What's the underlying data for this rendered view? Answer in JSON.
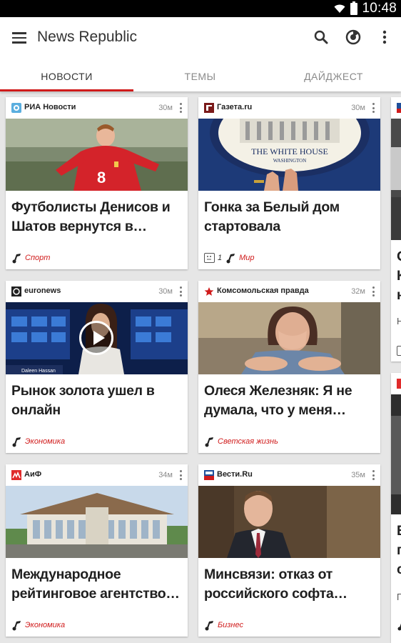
{
  "status": {
    "time": "10:48"
  },
  "app": {
    "title": "News Republic"
  },
  "tabs": [
    {
      "label": "НОВОСТИ",
      "active": true
    },
    {
      "label": "ТЕМЫ",
      "active": false
    },
    {
      "label": "ДАЙДЖЕСТ",
      "active": false
    }
  ],
  "cards": [
    {
      "source": "РИА Новости",
      "time": "30м",
      "title": "Футболисты Денисов и Шатов вернутся в…",
      "category": "Спорт"
    },
    {
      "source": "Газета.ru",
      "time": "30м",
      "title": "Гонка за Белый дом стартовала",
      "category": "Мир",
      "reactions": "1",
      "image_text": [
        "THE WHITE HOUSE",
        "WASHINGTON"
      ]
    },
    {
      "source": "euronews",
      "time": "30м",
      "title": "Рынок золота ушел в онлайн",
      "category": "Экономика",
      "caption": "Daleen Hassan"
    },
    {
      "source": "Комсомольская правда",
      "time": "32м",
      "title": "Олеся Железняк: Я не думала, что у меня…",
      "category": "Светская жизнь"
    },
    {
      "source": "АиФ",
      "time": "34м",
      "title": "Международное рейтинговое агентство…",
      "category": "Экономика"
    },
    {
      "source": "Вести.Ru",
      "time": "35м",
      "title": "Минсвязи: отказ от российского софта…",
      "category": "Бизнес"
    }
  ],
  "peek": {
    "top": [
      "О",
      "К",
      "н",
      "Н"
    ],
    "bottom": [
      "Е",
      "г",
      "с",
      "П"
    ]
  },
  "colors": {
    "accent": "#d01b1b"
  }
}
